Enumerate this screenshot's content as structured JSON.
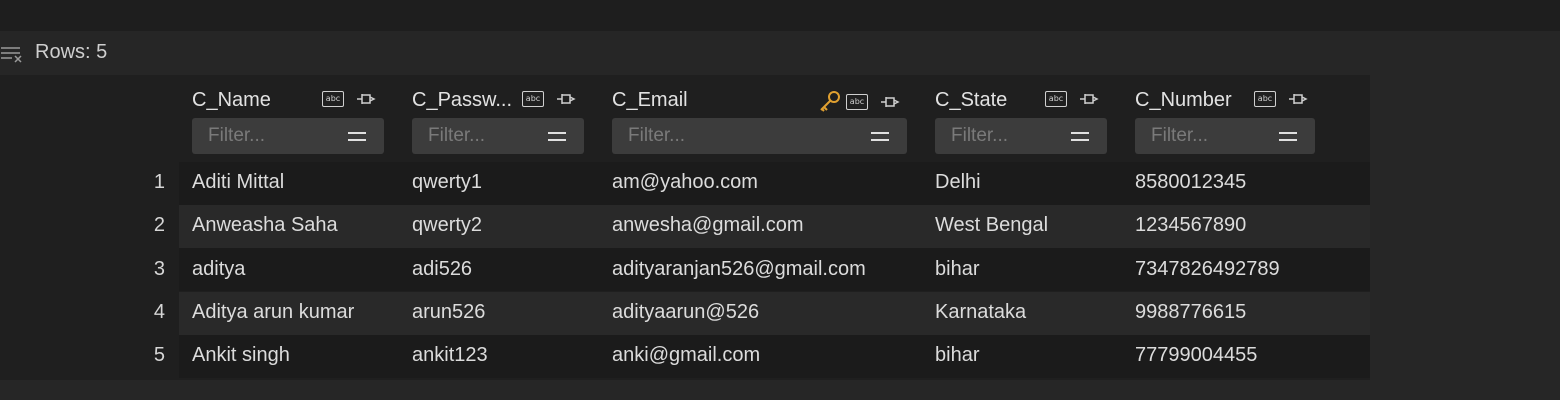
{
  "rows_label": "Rows: 5",
  "filter_placeholder": "Filter...",
  "columns": [
    {
      "key": "c_name",
      "label": "C_Name",
      "type_icon": "abc-icon",
      "key_icon": false
    },
    {
      "key": "c_password",
      "label": "C_Passw...",
      "type_icon": "abc-icon",
      "key_icon": false
    },
    {
      "key": "c_email",
      "label": "C_Email",
      "type_icon": "abc-icon",
      "key_icon": true
    },
    {
      "key": "c_state",
      "label": "C_State",
      "type_icon": "abc-icon",
      "key_icon": false
    },
    {
      "key": "c_number",
      "label": "C_Number",
      "type_icon": "abc-icon",
      "key_icon": false
    }
  ],
  "type_icon_text": "abc",
  "rows": [
    {
      "num": "1",
      "cells": [
        "Aditi Mittal",
        "qwerty1",
        "am@yahoo.com",
        "Delhi",
        "8580012345"
      ]
    },
    {
      "num": "2",
      "cells": [
        "Anweasha Saha",
        "qwerty2",
        "anwesha@gmail.com",
        "West Bengal",
        "1234567890"
      ]
    },
    {
      "num": "3",
      "cells": [
        "aditya",
        "adi526",
        "adityaranjan526@gmail.com",
        "bihar",
        "7347826492789"
      ]
    },
    {
      "num": "4",
      "cells": [
        "Aditya arun kumar",
        "arun526",
        "adityaarun@526",
        "Karnataka",
        "9988776615"
      ]
    },
    {
      "num": "5",
      "cells": [
        "Ankit singh",
        "ankit123",
        "anki@gmail.com",
        "bihar",
        "77799004455"
      ]
    }
  ],
  "colors": {
    "accent_key": "#e0a030",
    "background": "#262626",
    "grid_background": "#1f1f1f"
  }
}
